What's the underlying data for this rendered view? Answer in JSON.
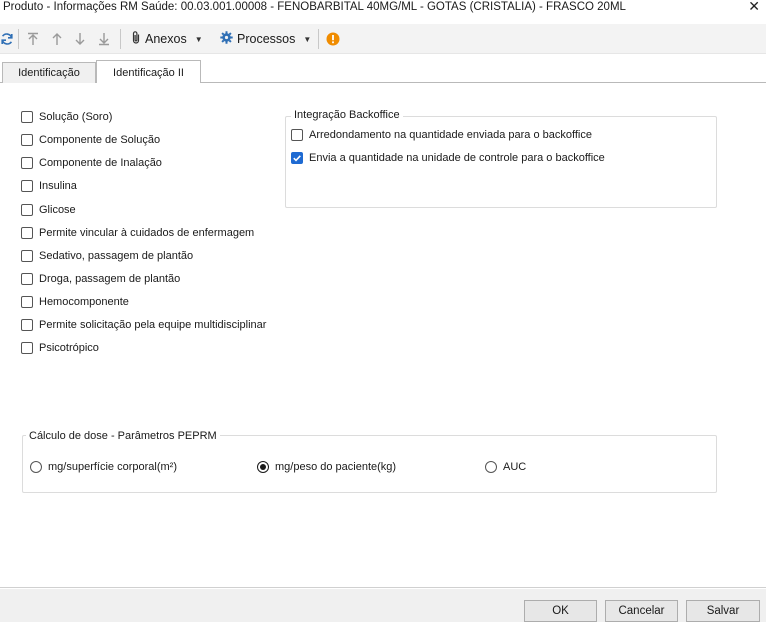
{
  "window": {
    "title": "Produto - Informações RM Saúde: 00.03.001.00008 - FENOBARBITAL 40MG/ML - GOTAS (CRISTALIA) - FRASCO 20ML",
    "close_glyph": "✕"
  },
  "toolbar": {
    "attachments_label": "Anexos",
    "processes_label": "Processos",
    "icons": [
      "refresh-icon",
      "first-icon",
      "previous-icon",
      "next-icon",
      "last-icon",
      "paperclip-icon",
      "gear-icon",
      "warning-icon"
    ]
  },
  "tabs": [
    {
      "label": "Identificação",
      "active": false
    },
    {
      "label": "Identificação II",
      "active": true
    }
  ],
  "left_options": [
    {
      "label": "Solução (Soro)",
      "checked": false
    },
    {
      "label": "Componente de Solução",
      "checked": false
    },
    {
      "label": "Componente de Inalação",
      "checked": false
    },
    {
      "label": "Insulina",
      "checked": false
    },
    {
      "label": "Glicose",
      "checked": false
    },
    {
      "label": "Permite vincular à cuidados de enfermagem",
      "checked": false
    },
    {
      "label": "Sedativo, passagem de plantão",
      "checked": false
    },
    {
      "label": "Droga, passagem de plantão",
      "checked": false
    },
    {
      "label": "Hemocomponente",
      "checked": false
    },
    {
      "label": "Permite solicitação pela equipe multidisciplinar",
      "checked": false
    },
    {
      "label": "Psicotrópico",
      "checked": false
    }
  ],
  "backoffice": {
    "title": "Integração Backoffice",
    "options": [
      {
        "label": "Arredondamento na quantidade enviada para o backoffice",
        "checked": false
      },
      {
        "label": "Envia a quantidade na unidade de controle para o backoffice",
        "checked": true
      }
    ]
  },
  "dose": {
    "title": "Cálculo de dose - Parâmetros PEPRM",
    "options": [
      {
        "label": "mg/superfície corporal(m²)",
        "selected": false
      },
      {
        "label": "mg/peso do paciente(kg)",
        "selected": true
      },
      {
        "label": "AUC",
        "selected": false
      }
    ]
  },
  "footer": {
    "ok_label": "OK",
    "cancel_label": "Cancelar",
    "save_label": "Salvar"
  },
  "colors": {
    "accent": "#1e6ad2",
    "warning": "#f08c00",
    "gear": "#2f6fb5"
  }
}
